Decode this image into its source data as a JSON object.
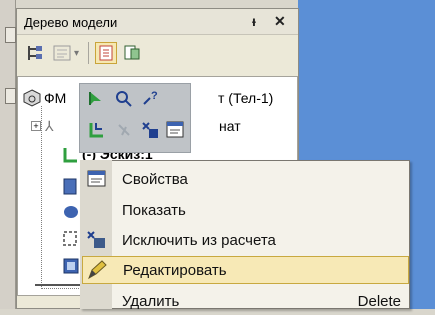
{
  "panel": {
    "title": "Дерево модели",
    "pin_glyph": "ᵻ",
    "close_glyph": "✕"
  },
  "tree": {
    "root_prefix": "ФМ",
    "root_suffix": "т (Тел-1)",
    "axes_suffix": "нат",
    "sketch_label": "(-) Эскиз:1"
  },
  "context_menu": {
    "items": [
      {
        "label": "Свойства",
        "icon": "properties-icon",
        "shortcut": ""
      },
      {
        "label": "Показать",
        "icon": "",
        "shortcut": ""
      },
      {
        "label": "Исключить из расчета",
        "icon": "exclude-icon",
        "shortcut": ""
      },
      {
        "label": "Редактировать",
        "icon": "pencil-icon",
        "shortcut": "",
        "selected": true
      },
      {
        "label": "Удалить",
        "icon": "",
        "shortcut": "Delete"
      }
    ]
  },
  "colors": {
    "workspace_blue": "#5b8fd6",
    "menu_highlight": "#f7e9b6"
  }
}
